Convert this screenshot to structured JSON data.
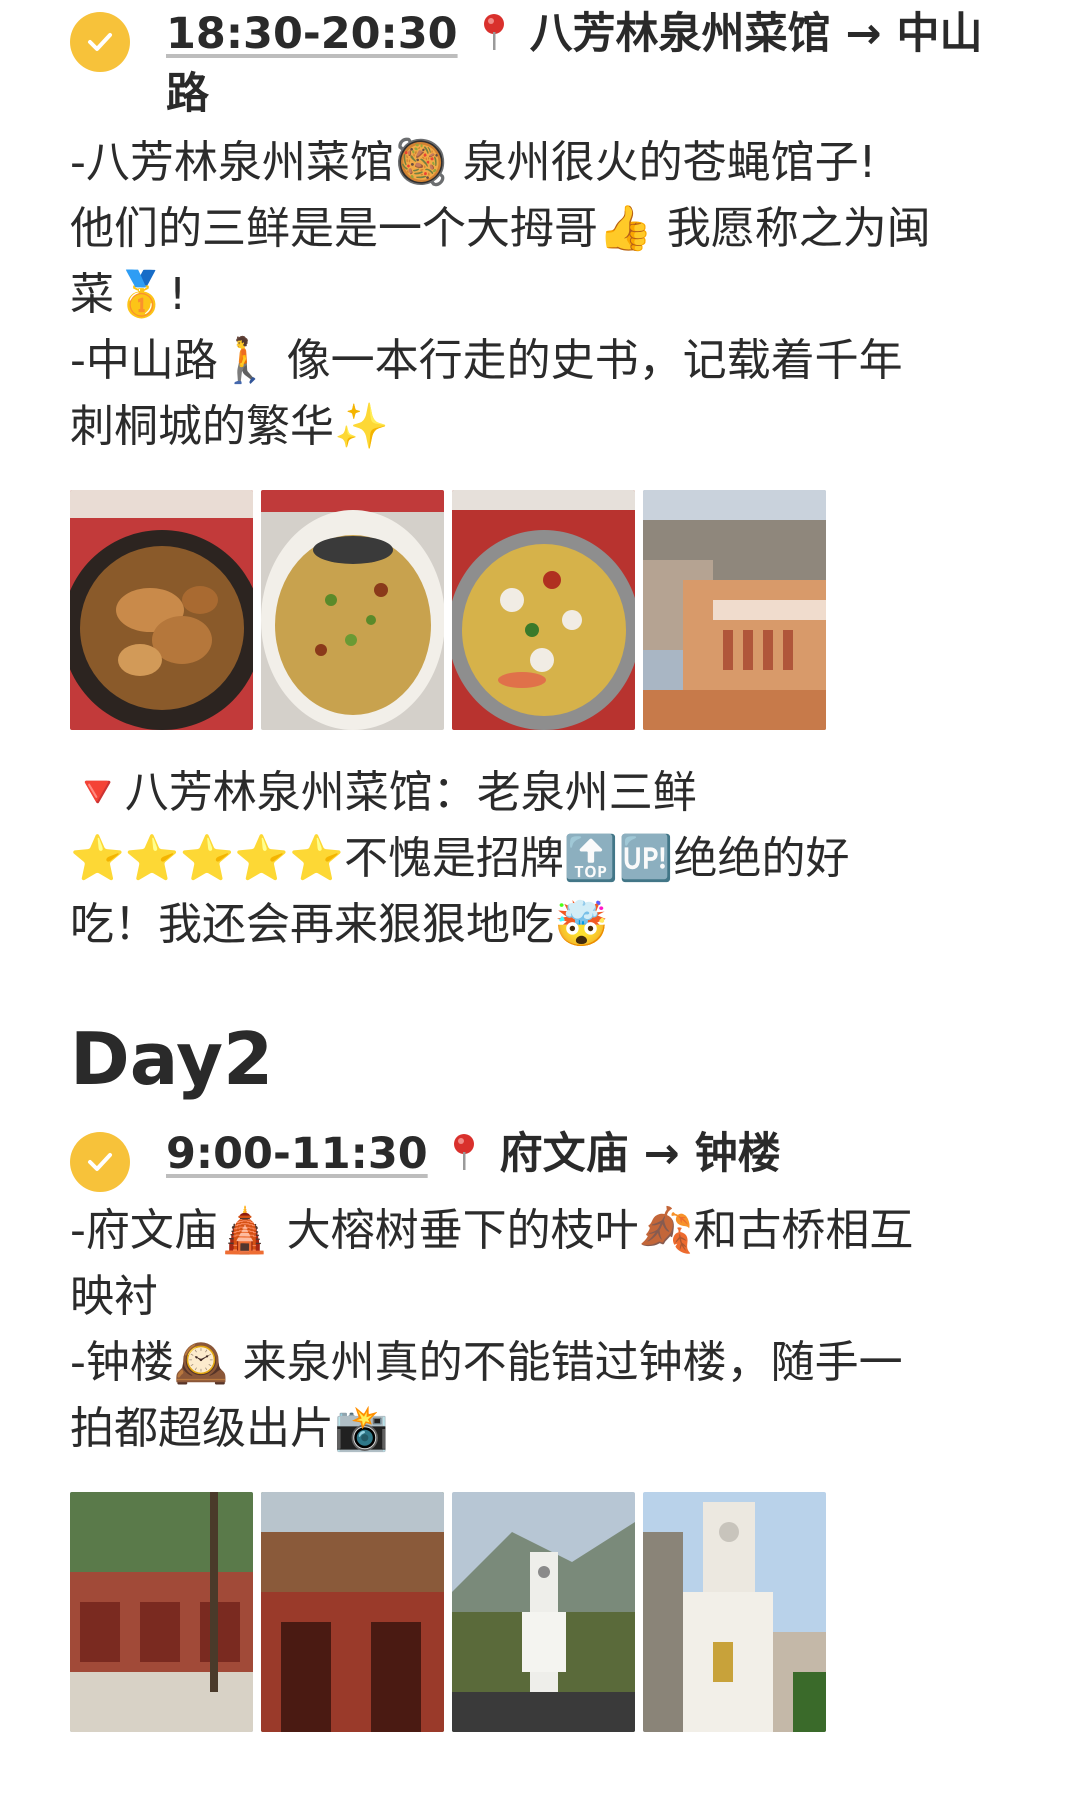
{
  "section1": {
    "time": "18:30-20:30",
    "route": "八芳林泉州菜馆 → 中山",
    "route_line2": "路",
    "lines": [
      "-八芳林泉州菜馆🥘 泉州很火的苍蝇馆子!",
      "他们的三鲜是是一个大拇哥👍 我愿称之为闽",
      "菜🥇!",
      "-中山路🚶 像一本行走的史书，记载着千年",
      "刺桐城的繁华✨"
    ],
    "review_line1": "🔻八芳林泉州菜馆：老泉州三鲜",
    "review_stars": "⭐⭐⭐⭐⭐",
    "review_line2_rest": "不愧是招牌🔝🆙绝绝的好",
    "review_line3": "吃！我还会再来狠狠地吃🤯"
  },
  "day2": {
    "title": "Day2"
  },
  "section2": {
    "time": "9:00-11:30",
    "route": "府文庙 → 钟楼",
    "lines": [
      "-府文庙🛕 大榕树垂下的枝叶🍂和古桥相互",
      "映衬",
      "-钟楼🕰️ 来泉州真的不能错过钟楼，随手一",
      "拍都超级出片📸"
    ]
  },
  "colors": {
    "check_badge": "#f7c23a",
    "pin_red": "#d9302c",
    "text": "#2b2b2b"
  },
  "icons": {
    "check": "check-circle-icon",
    "pin": "map-pin-icon"
  }
}
